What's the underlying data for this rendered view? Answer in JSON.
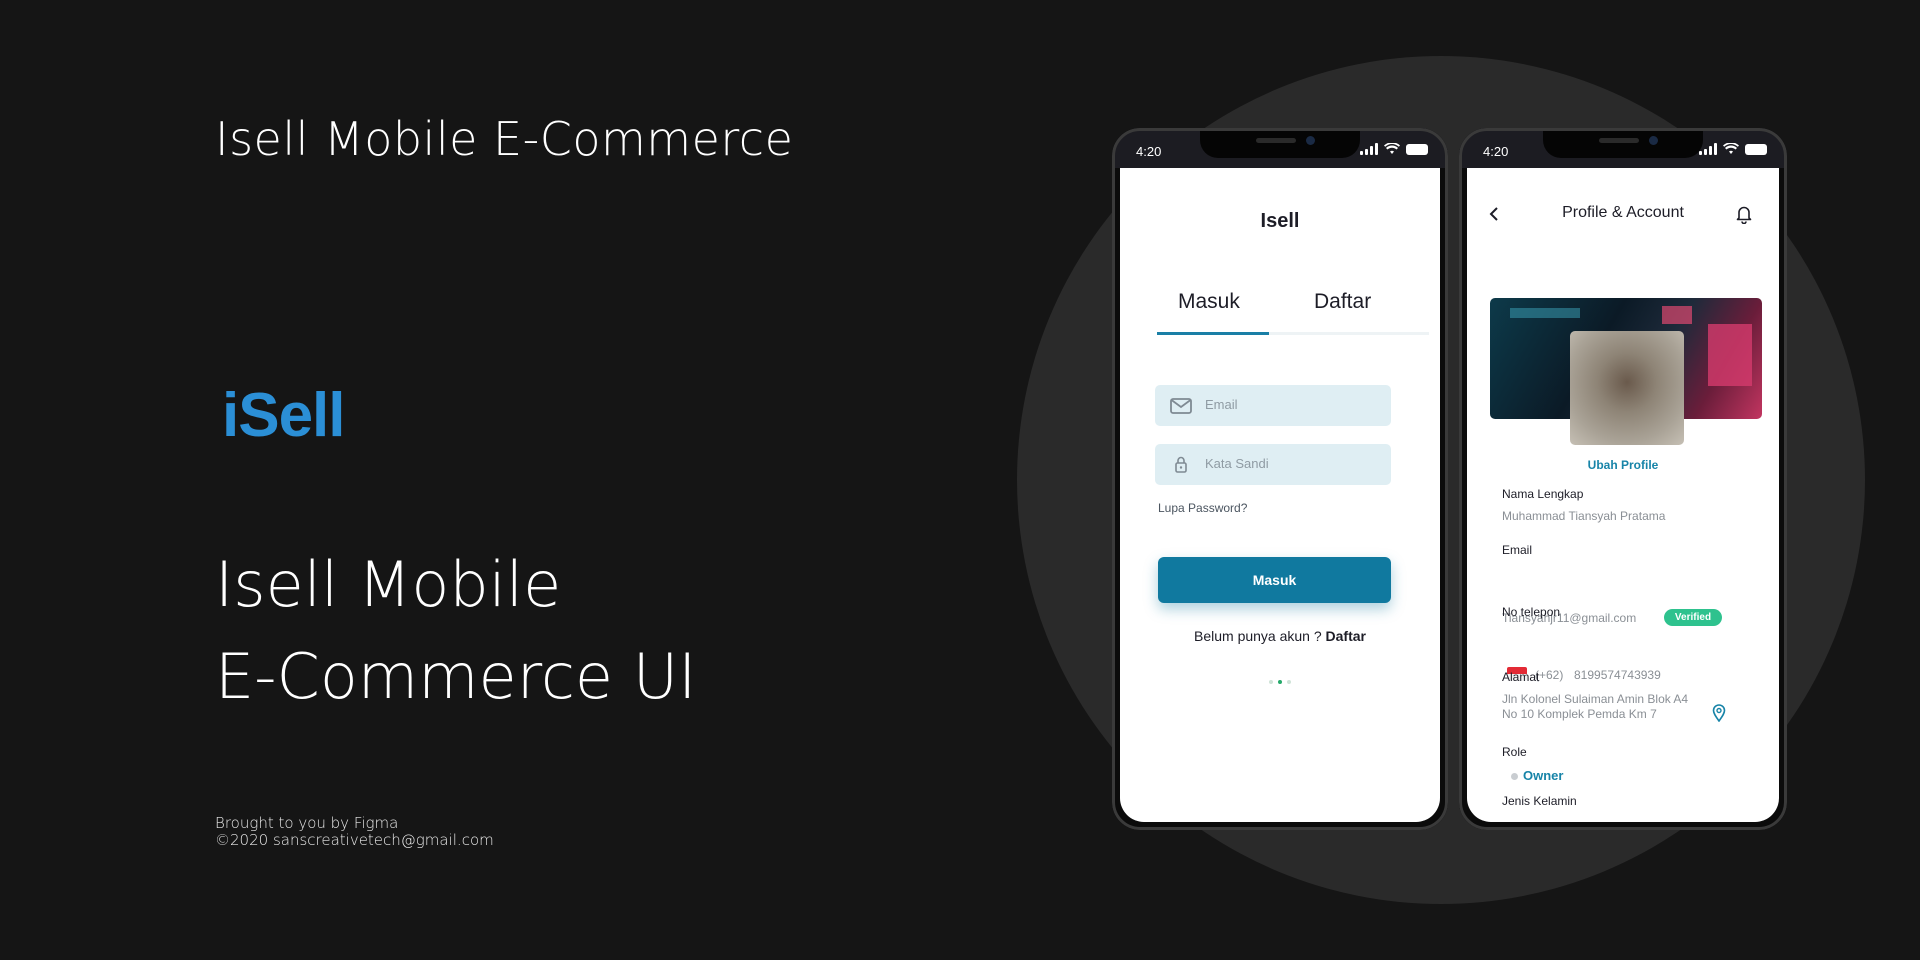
{
  "hero": {
    "title": "Isell Mobile E-Commerce",
    "logo": "iSell",
    "headline_line1": "Isell Mobile",
    "headline_line2": "E-Commerce UI",
    "credit_line1": "Brought to you by Figma",
    "credit_line2": "©2020 sanscreativetech@gmail.com"
  },
  "status_bar": {
    "time": "4:20"
  },
  "login_screen": {
    "app_title": "Isell",
    "tabs": [
      {
        "label": "Masuk",
        "active": true
      },
      {
        "label": "Daftar",
        "active": false
      }
    ],
    "email_placeholder": "Email",
    "password_placeholder": "Kata Sandi",
    "forgot_password": "Lupa Password?",
    "submit_label": "Masuk",
    "signup_prompt": "Belum punya akun ?",
    "signup_link": "Daftar",
    "page_indicator": {
      "count": 3,
      "active_index": 1
    }
  },
  "profile_screen": {
    "title": "Profile & Account",
    "edit_profile": "Ubah Profile",
    "fields": {
      "name_label": "Nama Lengkap",
      "name_value": "Muhammad Tiansyah Pratama",
      "email_label": "Email",
      "email_value": "Tiansyahjr11@gmail.com",
      "email_badge": "Verified",
      "phone_label": "No telepon",
      "phone_code": "(+62)",
      "phone_value": "8199574743939",
      "address_label": "Alamat",
      "address_line1": "Jln Kolonel Sulaiman Amin Blok A4",
      "address_line2": "No 10 Komplek Pemda Km 7",
      "role_label": "Role",
      "role_value": "Owner",
      "gender_label": "Jenis Kelamin"
    }
  },
  "colors": {
    "background": "#151515",
    "accent_logo": "#2b8fd6",
    "primary_button": "#10799f",
    "verified": "#2ec28e",
    "link": "#1784a8"
  },
  "icons": [
    "mail-icon",
    "lock-icon",
    "back-arrow-icon",
    "bell-icon",
    "location-pin-icon",
    "signal-icon",
    "wifi-icon",
    "battery-icon"
  ]
}
